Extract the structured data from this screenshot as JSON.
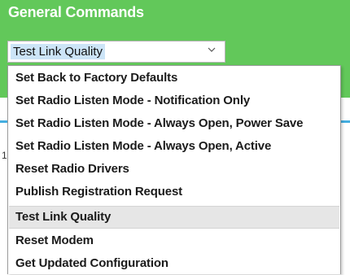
{
  "panel": {
    "title": "General Commands",
    "background": "#62c85a"
  },
  "select": {
    "value": "Test Link Quality",
    "icon": "chevron-down-icon"
  },
  "underlay": {
    "char": "1"
  },
  "dropdown": {
    "options": [
      "Set Back to Factory Defaults",
      "Set Radio Listen Mode - Notification Only",
      "Set Radio Listen Mode - Always Open, Power Save",
      "Set Radio Listen Mode - Always Open, Active",
      "Reset Radio Drivers",
      "Publish Registration Request",
      "Test Link Quality",
      "Reset Modem",
      "Get Updated Configuration"
    ],
    "selected_index": 6
  }
}
